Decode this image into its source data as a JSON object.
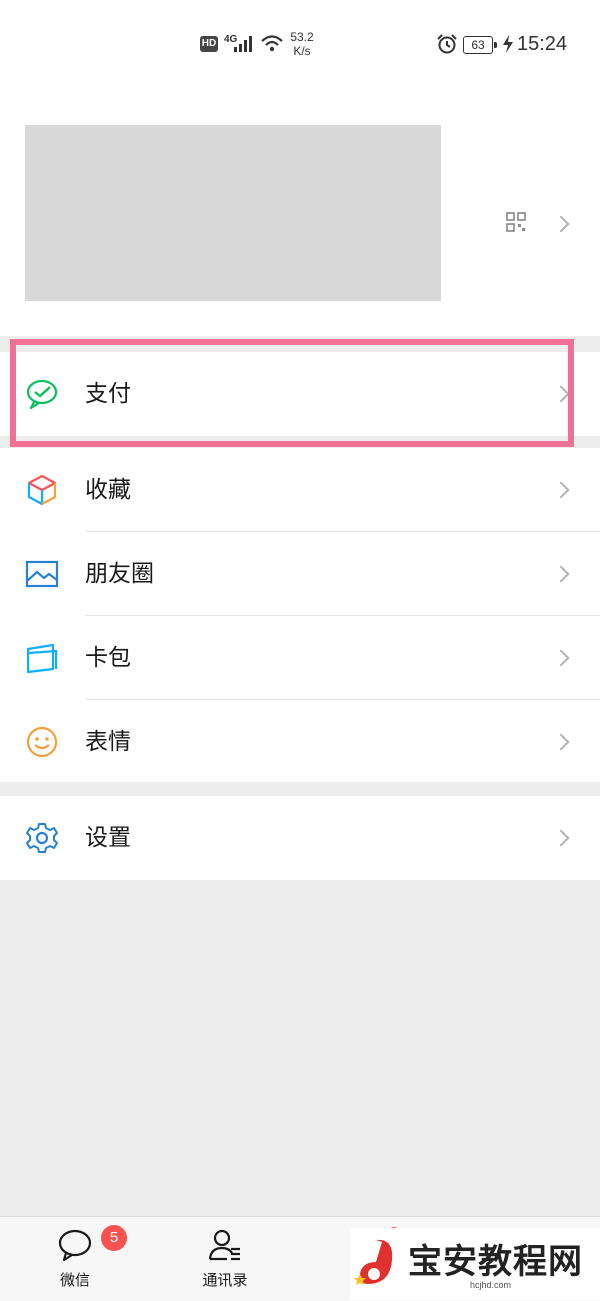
{
  "status_bar": {
    "hd": "HD",
    "network": "4G",
    "speed_value": "53.2",
    "speed_unit": "K/s",
    "battery": "63",
    "time": "15:24"
  },
  "profile": {
    "qr_icon": "qrcode-icon",
    "chevron_icon": "chevron-right-icon"
  },
  "menu_group_1": [
    {
      "label": "支付",
      "icon": "pay-icon",
      "color": "#07c160"
    }
  ],
  "menu_group_2": [
    {
      "label": "收藏",
      "icon": "favorites-cube-icon"
    },
    {
      "label": "朋友圈",
      "icon": "moments-image-icon",
      "color": "#2782d7"
    },
    {
      "label": "卡包",
      "icon": "card-wallet-icon",
      "color": "#10aeff"
    },
    {
      "label": "表情",
      "icon": "emoji-smile-icon",
      "color": "#f6a03d"
    }
  ],
  "menu_group_3": [
    {
      "label": "设置",
      "icon": "settings-gear-icon",
      "color": "#2782d7"
    }
  ],
  "highlight_color": "#f07096",
  "tabbar": {
    "tabs": [
      {
        "label": "微信",
        "icon": "chat-bubble-icon",
        "badge": "5"
      },
      {
        "label": "通讯录",
        "icon": "contacts-icon"
      }
    ],
    "badge_color": "#fa5151"
  },
  "watermark": {
    "text": "宝安教程网",
    "url": "hcjhd.com"
  }
}
